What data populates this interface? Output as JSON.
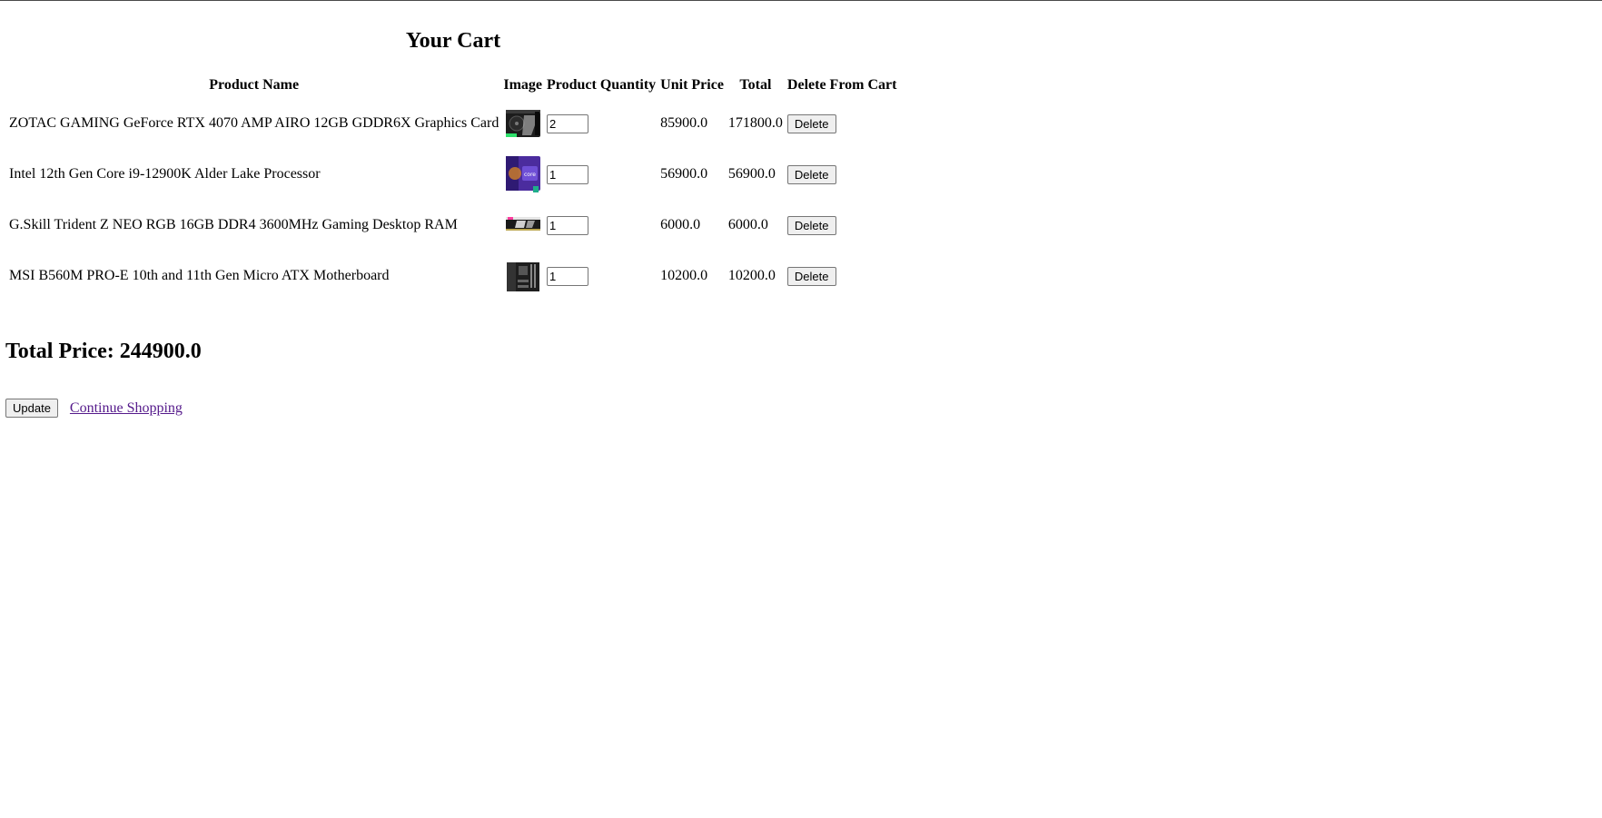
{
  "page": {
    "title": "Your Cart"
  },
  "table": {
    "headers": {
      "name": "Product Name",
      "image": "Image",
      "quantity": "Product Quantity",
      "unit_price": "Unit Price",
      "total": "Total",
      "delete": "Delete From Cart"
    },
    "rows": [
      {
        "name": "ZOTAC GAMING GeForce RTX 4070 AMP AIRO 12GB GDDR6X Graphics Card",
        "image_icon": "graphics-card-icon",
        "quantity": "2",
        "unit_price": "85900.0",
        "total": "171800.0",
        "delete_label": "Delete"
      },
      {
        "name": "Intel 12th Gen Core i9-12900K Alder Lake Processor",
        "image_icon": "processor-box-icon",
        "quantity": "1",
        "unit_price": "56900.0",
        "total": "56900.0",
        "delete_label": "Delete"
      },
      {
        "name": "G.Skill Trident Z NEO RGB 16GB DDR4 3600MHz Gaming Desktop RAM",
        "image_icon": "ram-stick-icon",
        "quantity": "1",
        "unit_price": "6000.0",
        "total": "6000.0",
        "delete_label": "Delete"
      },
      {
        "name": "MSI B560M PRO-E 10th and 11th Gen Micro ATX Motherboard",
        "image_icon": "motherboard-icon",
        "quantity": "1",
        "unit_price": "10200.0",
        "total": "10200.0",
        "delete_label": "Delete"
      }
    ]
  },
  "summary": {
    "total_price": "Total Price: 244900.0"
  },
  "actions": {
    "update_label": "Update",
    "continue_label": "Continue Shopping"
  },
  "colors": {
    "link_visited": "#551a8b",
    "button_bg": "#efefef",
    "border": "#767676"
  }
}
